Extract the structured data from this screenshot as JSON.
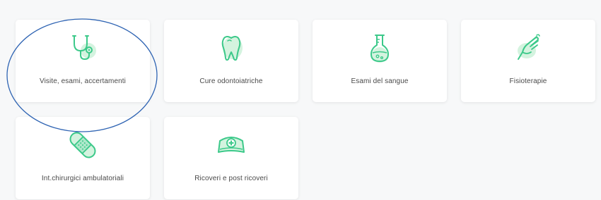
{
  "colors": {
    "accent": "#3cc98a",
    "accent_soft": "#c9f0d8",
    "highlight_ring": "#2f64b3"
  },
  "cards": [
    {
      "label": "Visite, esami, accertamenti",
      "icon": "stethoscope-icon"
    },
    {
      "label": "Cure odontoiatriche",
      "icon": "tooth-icon"
    },
    {
      "label": "Esami del sangue",
      "icon": "flask-icon"
    },
    {
      "label": "Fisioterapie",
      "icon": "hand-icon"
    },
    {
      "label": "Int.chirurgici ambulatoriali",
      "icon": "bandage-icon"
    },
    {
      "label": "Ricoveri e post ricoveri",
      "icon": "nurse-cap-icon"
    }
  ]
}
